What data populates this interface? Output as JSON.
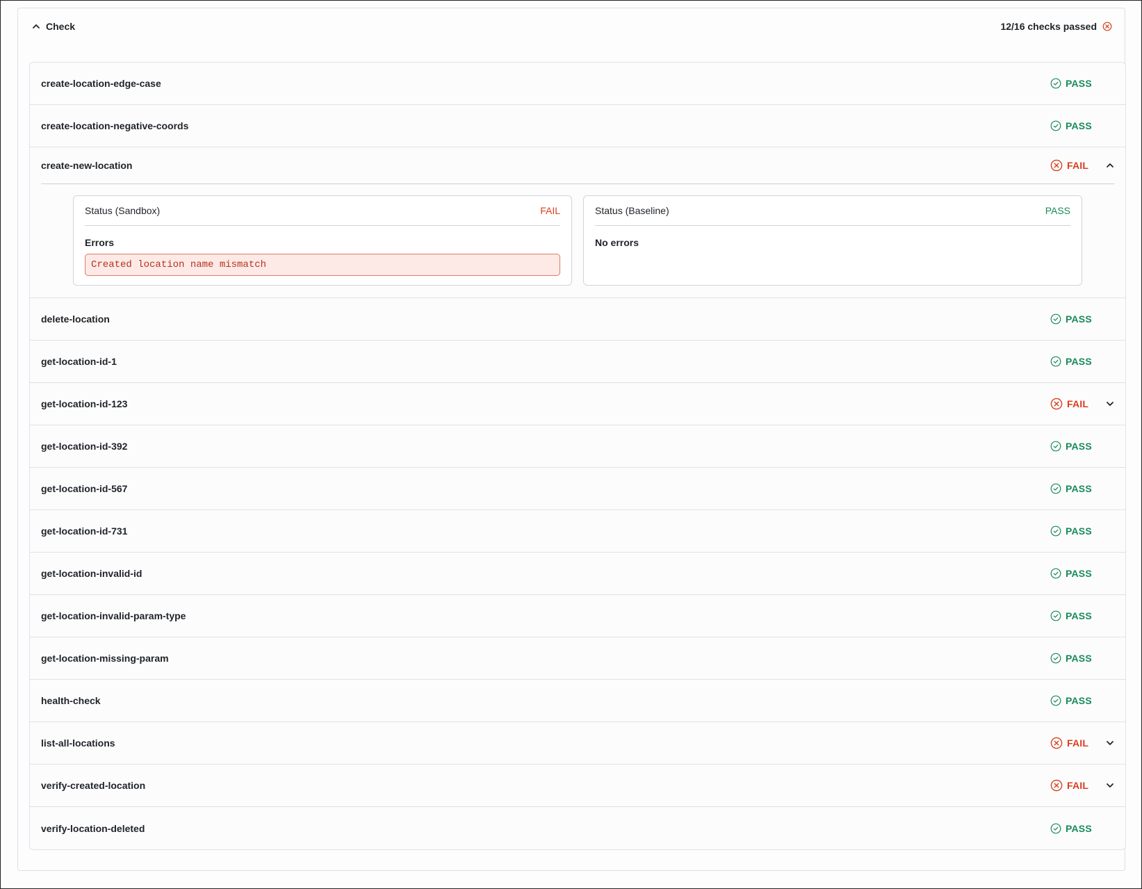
{
  "header": {
    "title": "Check",
    "summary": "12/16 checks passed"
  },
  "colors": {
    "pass": "#1a8a5a",
    "fail": "#d9401e"
  },
  "checks": [
    {
      "name": "create-location-edge-case",
      "status": "PASS"
    },
    {
      "name": "create-location-negative-coords",
      "status": "PASS"
    },
    {
      "name": "create-new-location",
      "status": "FAIL",
      "expanded": true
    },
    {
      "name": "delete-location",
      "status": "PASS"
    },
    {
      "name": "get-location-id-1",
      "status": "PASS"
    },
    {
      "name": "get-location-id-123",
      "status": "FAIL"
    },
    {
      "name": "get-location-id-392",
      "status": "PASS"
    },
    {
      "name": "get-location-id-567",
      "status": "PASS"
    },
    {
      "name": "get-location-id-731",
      "status": "PASS"
    },
    {
      "name": "get-location-invalid-id",
      "status": "PASS"
    },
    {
      "name": "get-location-invalid-param-type",
      "status": "PASS"
    },
    {
      "name": "get-location-missing-param",
      "status": "PASS"
    },
    {
      "name": "health-check",
      "status": "PASS"
    },
    {
      "name": "list-all-locations",
      "status": "FAIL"
    },
    {
      "name": "verify-created-location",
      "status": "FAIL"
    },
    {
      "name": "verify-location-deleted",
      "status": "PASS"
    }
  ],
  "detail": {
    "sandbox": {
      "label": "Status (Sandbox)",
      "status": "FAIL",
      "section": "Errors",
      "error": "Created location name mismatch"
    },
    "baseline": {
      "label": "Status (Baseline)",
      "status": "PASS",
      "section": "No errors"
    }
  }
}
